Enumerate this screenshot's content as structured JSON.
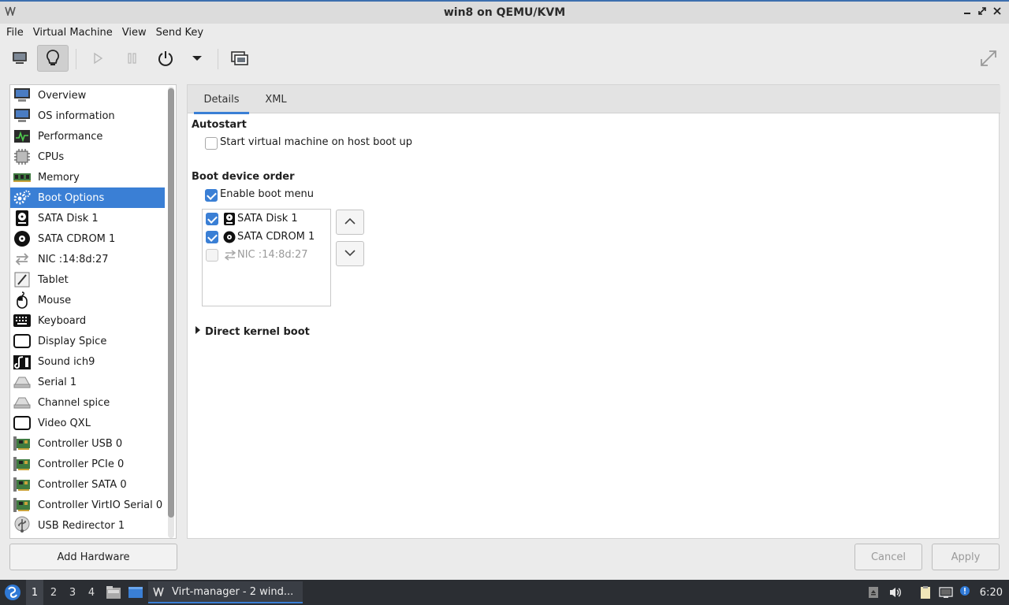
{
  "window": {
    "title": "win8 on QEMU/KVM",
    "app_icon": "virt-manager-icon",
    "controls": [
      "minimize-icon",
      "restore-icon",
      "close-icon"
    ]
  },
  "menubar": {
    "items": [
      "File",
      "Virtual Machine",
      "View",
      "Send Key"
    ]
  },
  "toolbar": {
    "buttons": [
      "console-view",
      "details-view",
      "run",
      "pause",
      "shutdown",
      "shutdown-menu",
      "snapshots",
      "fullscreen"
    ],
    "active": "details-view"
  },
  "sidebar": {
    "items": [
      {
        "label": "Overview",
        "icon": "monitor-icon"
      },
      {
        "label": "OS information",
        "icon": "monitor-icon"
      },
      {
        "label": "Performance",
        "icon": "performance-icon"
      },
      {
        "label": "CPUs",
        "icon": "cpu-icon"
      },
      {
        "label": "Memory",
        "icon": "memory-icon"
      },
      {
        "label": "Boot Options",
        "icon": "gears-icon"
      },
      {
        "label": "SATA Disk 1",
        "icon": "disk-icon"
      },
      {
        "label": "SATA CDROM 1",
        "icon": "cdrom-icon"
      },
      {
        "label": "NIC :14:8d:27",
        "icon": "network-icon"
      },
      {
        "label": "Tablet",
        "icon": "tablet-icon"
      },
      {
        "label": "Mouse",
        "icon": "mouse-icon"
      },
      {
        "label": "Keyboard",
        "icon": "keyboard-icon"
      },
      {
        "label": "Display Spice",
        "icon": "display-icon"
      },
      {
        "label": "Sound ich9",
        "icon": "sound-icon"
      },
      {
        "label": "Serial 1",
        "icon": "serial-icon"
      },
      {
        "label": "Channel spice",
        "icon": "serial-icon"
      },
      {
        "label": "Video QXL",
        "icon": "display-icon"
      },
      {
        "label": "Controller USB 0",
        "icon": "controller-icon"
      },
      {
        "label": "Controller PCIe 0",
        "icon": "controller-icon"
      },
      {
        "label": "Controller SATA 0",
        "icon": "controller-icon"
      },
      {
        "label": "Controller VirtIO Serial 0",
        "icon": "controller-icon"
      },
      {
        "label": "USB Redirector 1",
        "icon": "usb-icon"
      }
    ],
    "selected": "Boot Options",
    "add_hardware": "Add Hardware"
  },
  "tabs": [
    "Details",
    "XML"
  ],
  "active_tab": "Details",
  "details": {
    "autostart": {
      "title": "Autostart",
      "checkbox_label": "Start virtual machine on host boot up",
      "checked": false
    },
    "boot_order": {
      "title": "Boot device order",
      "enable_menu_label": "Enable boot menu",
      "enable_menu_checked": true,
      "devices": [
        {
          "label": "SATA Disk 1",
          "checked": true,
          "icon": "disk-icon",
          "enabled": true
        },
        {
          "label": "SATA CDROM 1",
          "checked": true,
          "icon": "cdrom-icon",
          "enabled": true
        },
        {
          "label": "NIC :14:8d:27",
          "checked": false,
          "icon": "network-icon",
          "enabled": false
        }
      ]
    },
    "direct_kernel": {
      "title": "Direct kernel boot",
      "expanded": false
    }
  },
  "buttons": {
    "cancel": "Cancel",
    "apply": "Apply"
  },
  "taskbar": {
    "workspaces": [
      "1",
      "2",
      "3",
      "4"
    ],
    "active_workspace": "1",
    "task_label": "Virt-manager - 2 wind...",
    "clock": "6:20"
  }
}
